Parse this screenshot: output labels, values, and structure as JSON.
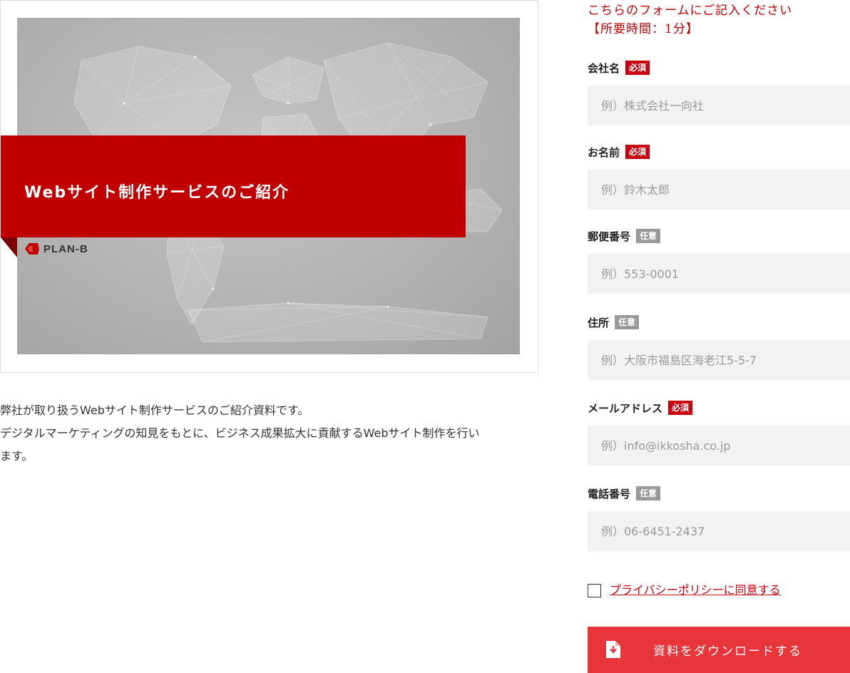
{
  "document": {
    "banner_title": "Webサイト制作サービスのご紹介",
    "logo_text": "PLAN-B",
    "description_lines": [
      "弊社が取り扱うWebサイト制作サービスのご紹介資料です。",
      "デジタルマーケティングの知見をもとに、ビジネス成果拡大に貢献するWebサイト制作を行い",
      "ます。"
    ]
  },
  "form": {
    "intro_line1": "こちらのフォームにご記入ください",
    "intro_line2": "【所要時間：1分】",
    "fields": [
      {
        "label": "会社名",
        "badge": "必須",
        "required": true,
        "placeholder": "例）株式会社一向社"
      },
      {
        "label": "お名前",
        "badge": "必須",
        "required": true,
        "placeholder": "例）鈴木太郎"
      },
      {
        "label": "郵便番号",
        "badge": "任意",
        "required": false,
        "placeholder": "例）553-0001"
      },
      {
        "label": "住所",
        "badge": "任意",
        "required": false,
        "placeholder": "例）大阪市福島区海老江5-5-7"
      },
      {
        "label": "メールアドレス",
        "badge": "必須",
        "required": true,
        "placeholder": "例）info@ikkosha.co.jp"
      },
      {
        "label": "電話番号",
        "badge": "任意",
        "required": false,
        "placeholder": "例）06-6451-2437"
      }
    ],
    "privacy_label": "プライバシーポリシーに同意する",
    "privacy_checked": false,
    "submit_label": "資料をダウンロードする",
    "submit_icon": "download-document-icon"
  },
  "colors": {
    "accent_red": "#c00000",
    "required_badge": "#c8000f",
    "optional_badge": "#999999",
    "submit_button": "#e8353c",
    "input_background": "#f2f2f2"
  }
}
